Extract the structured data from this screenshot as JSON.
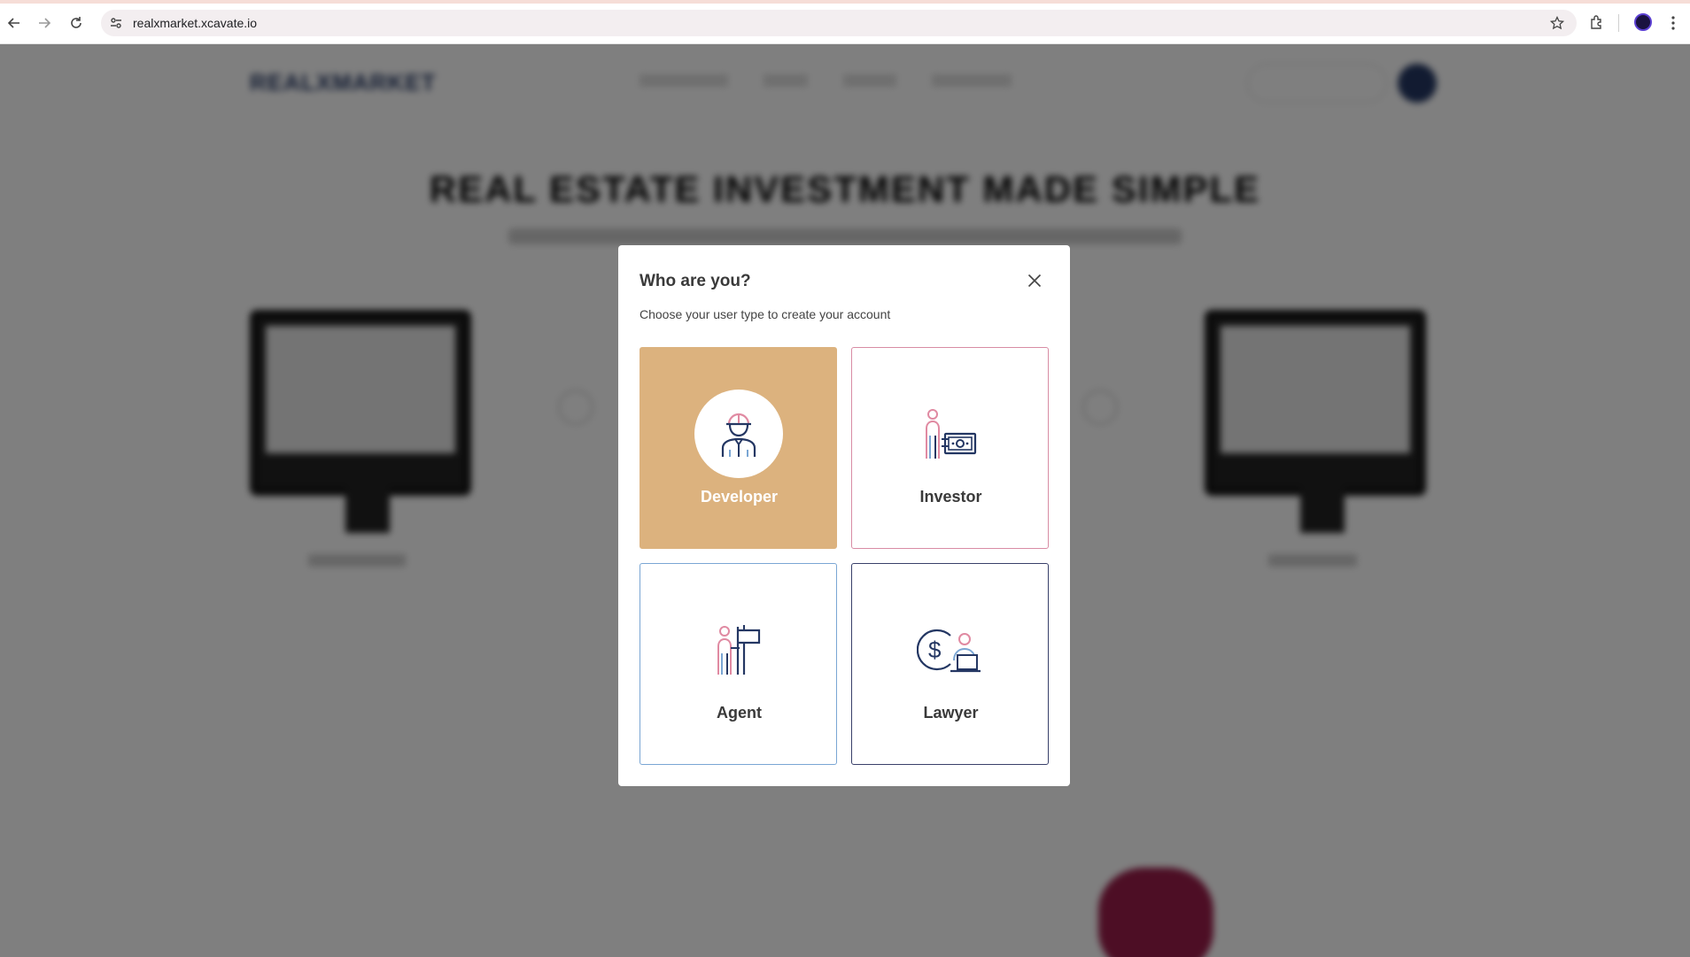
{
  "browser": {
    "url": "realxmarket.xcavate.io"
  },
  "background_page": {
    "logo": "REALXMARKET",
    "hero_heading": "REAL ESTATE INVESTMENT MADE SIMPLE"
  },
  "modal": {
    "title": "Who are you?",
    "subtitle": "Choose your user type to create your account",
    "options": [
      {
        "label": "Developer",
        "icon": "developer-hardhat-icon",
        "selected": true,
        "border_color": "#dcb27e"
      },
      {
        "label": "Investor",
        "icon": "investor-money-icon",
        "selected": false,
        "border_color": "#d88ca4"
      },
      {
        "label": "Agent",
        "icon": "agent-sign-icon",
        "selected": false,
        "border_color": "#7aa6d4"
      },
      {
        "label": "Lawyer",
        "icon": "lawyer-dollar-icon",
        "selected": false,
        "border_color": "#39406a"
      }
    ]
  },
  "colors": {
    "accent": "#dcb27e",
    "navy": "#243763",
    "pink": "#d88ca4",
    "blue": "#7aa6d4"
  }
}
